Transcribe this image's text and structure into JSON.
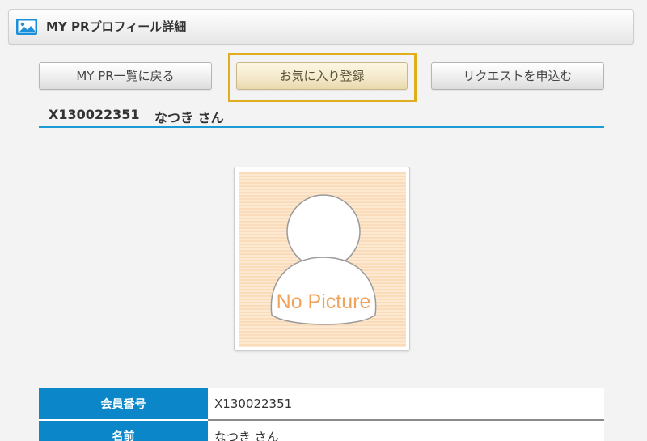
{
  "header": {
    "title": "MY PRプロフィール詳細",
    "icon": "image-icon"
  },
  "buttons": {
    "back": "MY PR一覧に戻る",
    "favorite": "お気に入り登録",
    "request": "リクエストを申込む"
  },
  "member": {
    "id": "X130022351",
    "name": "なつき さん"
  },
  "photo": {
    "placeholder_text": "No Picture",
    "icon": "avatar-placeholder-icon"
  },
  "table": {
    "rows": [
      {
        "label": "会員番号",
        "value": "X130022351"
      },
      {
        "label": "名前",
        "value": "なつき さん"
      }
    ]
  },
  "colors": {
    "accent_blue": "#0b87c9",
    "heading_rule": "#1b9ad6",
    "highlight_frame": "#e0ad1c",
    "placeholder_bg": "#fbe2c6",
    "placeholder_text": "#f0a35a"
  }
}
